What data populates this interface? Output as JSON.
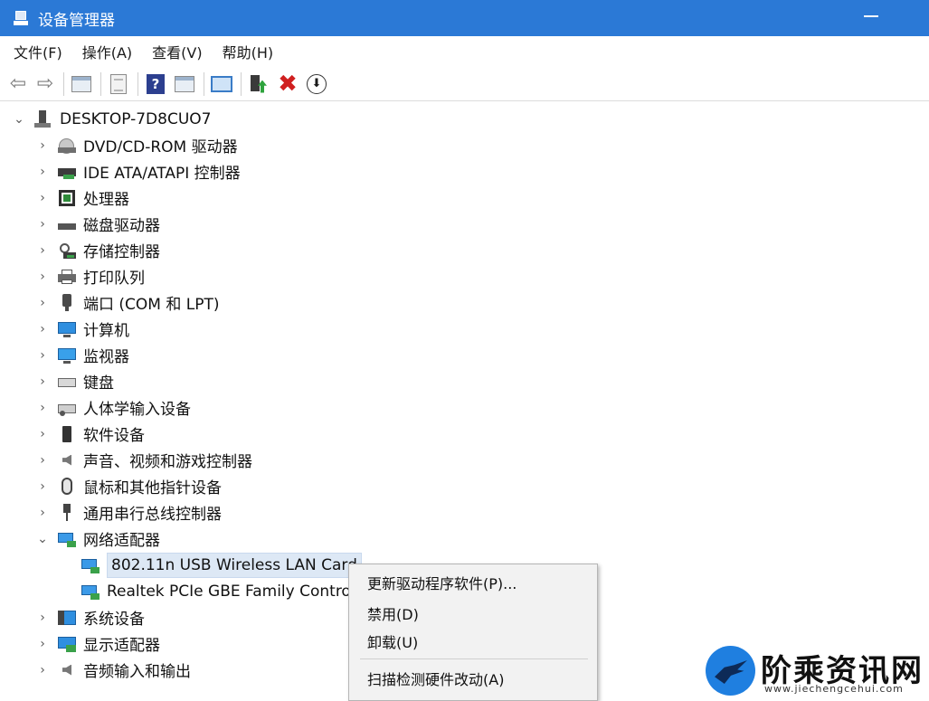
{
  "window": {
    "title": "设备管理器"
  },
  "menu": [
    "文件(F)",
    "操作(A)",
    "查看(V)",
    "帮助(H)"
  ],
  "toolbar": {
    "back_icon": "arrow-left-icon",
    "forward_icon": "arrow-right-icon",
    "help_glyph": "?",
    "uninstall_glyph": "✖",
    "update_glyph": "⬇"
  },
  "tree": {
    "computer": "DESKTOP-7D8CUO7",
    "categories": [
      "DVD/CD-ROM 驱动器",
      "IDE ATA/ATAPI 控制器",
      "处理器",
      "磁盘驱动器",
      "存储控制器",
      "打印队列",
      "端口 (COM 和 LPT)",
      "计算机",
      "监视器",
      "键盘",
      "人体学输入设备",
      "软件设备",
      "声音、视频和游戏控制器",
      "鼠标和其他指针设备",
      "通用串行总线控制器",
      "网络适配器",
      "系统设备",
      "显示适配器",
      "音频输入和输出"
    ],
    "network_adapters": [
      "802.11n USB Wireless LAN Card",
      "Realtek PCIe GBE Family Controller"
    ]
  },
  "context_menu": {
    "update_driver": "更新驱动程序软件(P)...",
    "disable": "禁用(D)",
    "uninstall": "卸载(U)",
    "scan": "扫描检测硬件改动(A)"
  },
  "watermark": {
    "text": "阶乘资讯网",
    "url": "www.jiechengcehui.com"
  },
  "colors": {
    "titlebar": "#2b79d6",
    "selection": "#dde8f5",
    "uninstall": "#d01f1f"
  }
}
